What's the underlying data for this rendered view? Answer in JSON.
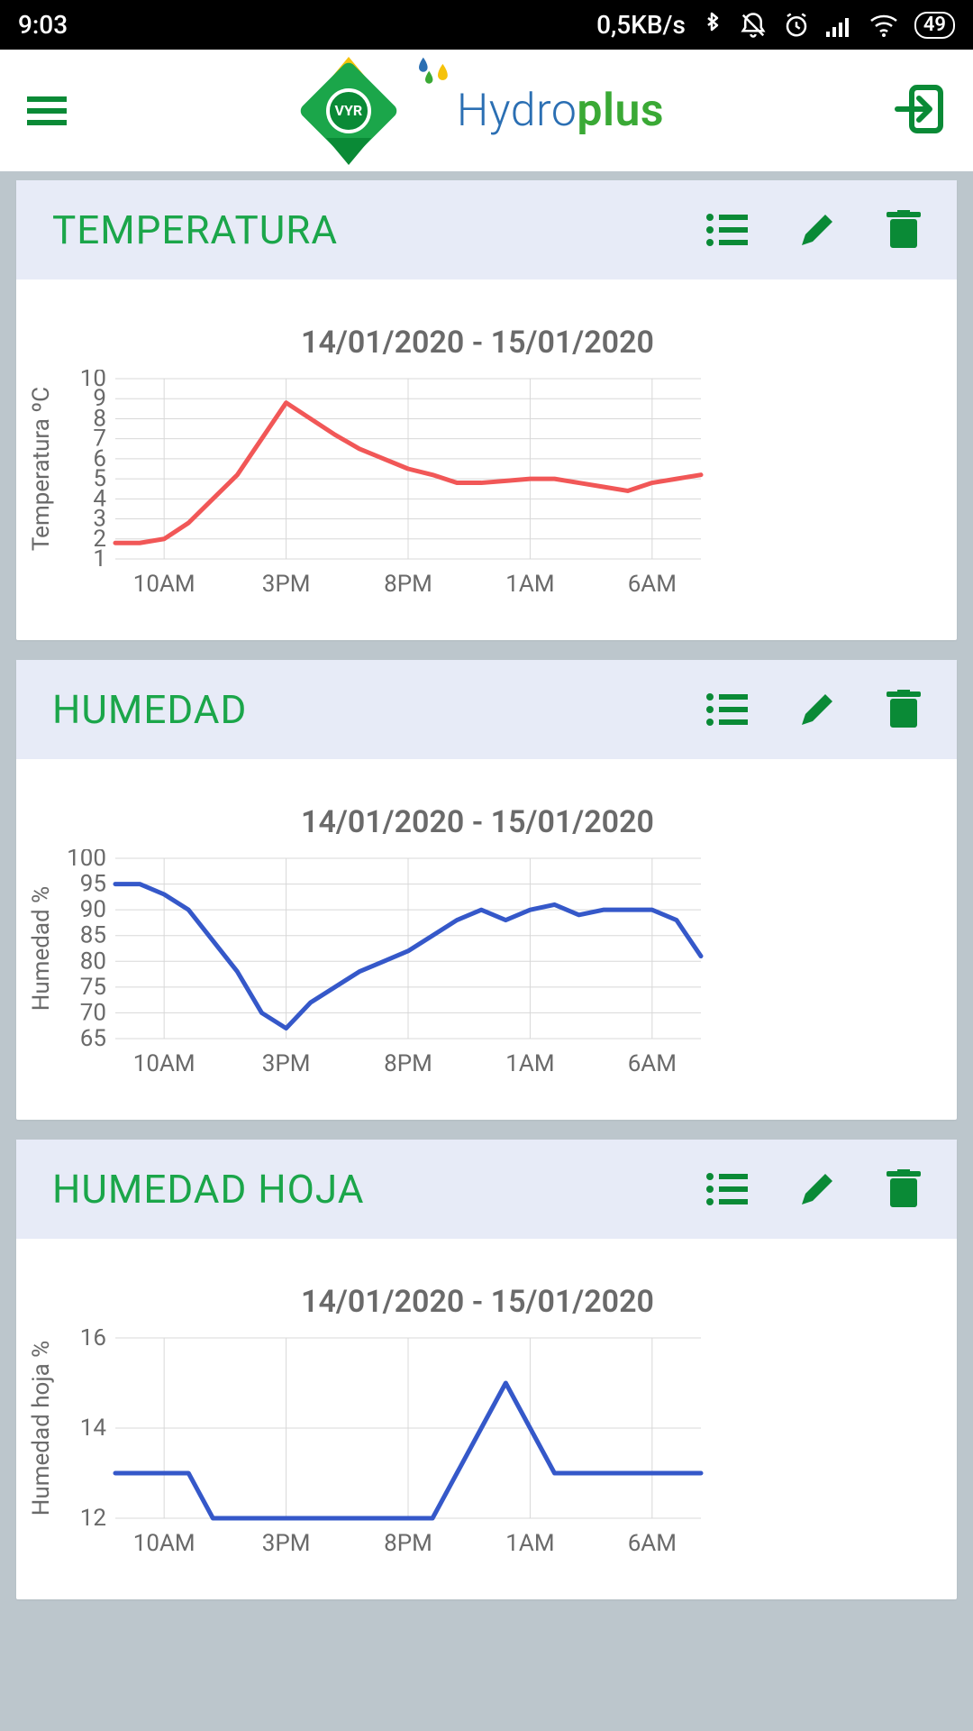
{
  "status": {
    "time": "9:03",
    "network_speed": "0,5KB/s",
    "battery": "49"
  },
  "brand": {
    "vyr_text": "VYR",
    "hydro": "Hydro",
    "plus": "plus"
  },
  "cards": [
    {
      "title": "TEMPERATURA",
      "date_range": "14/01/2020 - 15/01/2020",
      "ylabel": "Temperatura ºC"
    },
    {
      "title": "HUMEDAD",
      "date_range": "14/01/2020 - 15/01/2020",
      "ylabel": "Humedad %"
    },
    {
      "title": "HUMEDAD HOJA",
      "date_range": "14/01/2020 - 15/01/2020",
      "ylabel": "Humedad hoja %"
    }
  ],
  "chart_data": [
    {
      "type": "line",
      "title": "14/01/2020 - 15/01/2020",
      "xlabel": "",
      "ylabel": "Temperatura ºC",
      "x_ticks": [
        "10AM",
        "3PM",
        "8PM",
        "1AM",
        "6AM"
      ],
      "y_ticks": [
        1,
        2,
        3,
        4,
        5,
        6,
        7,
        8,
        9,
        10
      ],
      "ylim": [
        1,
        10
      ],
      "color": "#f15757",
      "series": [
        {
          "name": "Temperatura",
          "x_hours": [
            8,
            9,
            10,
            11,
            12,
            13,
            14,
            15,
            16,
            17,
            18,
            19,
            20,
            21,
            22,
            23,
            24,
            25,
            26,
            27,
            28,
            29,
            30,
            31,
            32
          ],
          "values": [
            1.8,
            1.8,
            2.0,
            2.8,
            4.0,
            5.2,
            7.0,
            8.8,
            8.0,
            7.2,
            6.5,
            6.0,
            5.5,
            5.2,
            4.8,
            4.8,
            4.9,
            5.0,
            5.0,
            4.8,
            4.6,
            4.4,
            4.8,
            5.0,
            5.2
          ]
        }
      ]
    },
    {
      "type": "line",
      "title": "14/01/2020 - 15/01/2020",
      "xlabel": "",
      "ylabel": "Humedad %",
      "x_ticks": [
        "10AM",
        "3PM",
        "8PM",
        "1AM",
        "6AM"
      ],
      "y_ticks": [
        65,
        70,
        75,
        80,
        85,
        90,
        95,
        100
      ],
      "ylim": [
        65,
        100
      ],
      "color": "#3558c9",
      "series": [
        {
          "name": "Humedad",
          "x_hours": [
            8,
            9,
            10,
            11,
            12,
            13,
            14,
            15,
            16,
            17,
            18,
            19,
            20,
            21,
            22,
            23,
            24,
            25,
            26,
            27,
            28,
            29,
            30,
            31,
            32
          ],
          "values": [
            95,
            95,
            93,
            90,
            84,
            78,
            70,
            67,
            72,
            75,
            78,
            80,
            82,
            85,
            88,
            90,
            88,
            90,
            91,
            89,
            90,
            90,
            90,
            88,
            81
          ]
        }
      ]
    },
    {
      "type": "line",
      "title": "14/01/2020 - 15/01/2020",
      "xlabel": "",
      "ylabel": "Humedad hoja %",
      "x_ticks": [
        "10AM",
        "3PM",
        "8PM",
        "1AM",
        "6AM"
      ],
      "y_ticks": [
        12,
        14,
        16
      ],
      "ylim": [
        12,
        16
      ],
      "color": "#3558c9",
      "series": [
        {
          "name": "Humedad hoja",
          "x_hours": [
            8,
            9,
            10,
            11,
            12,
            13,
            14,
            15,
            16,
            17,
            18,
            19,
            20,
            21,
            22,
            23,
            24,
            25,
            26,
            27,
            28,
            29,
            30,
            31,
            32
          ],
          "values": [
            13,
            13,
            13,
            13,
            12,
            12,
            12,
            12,
            12,
            12,
            12,
            12,
            12,
            12,
            13,
            14,
            15,
            14,
            13,
            13,
            13,
            13,
            13,
            13,
            13
          ]
        }
      ]
    }
  ]
}
